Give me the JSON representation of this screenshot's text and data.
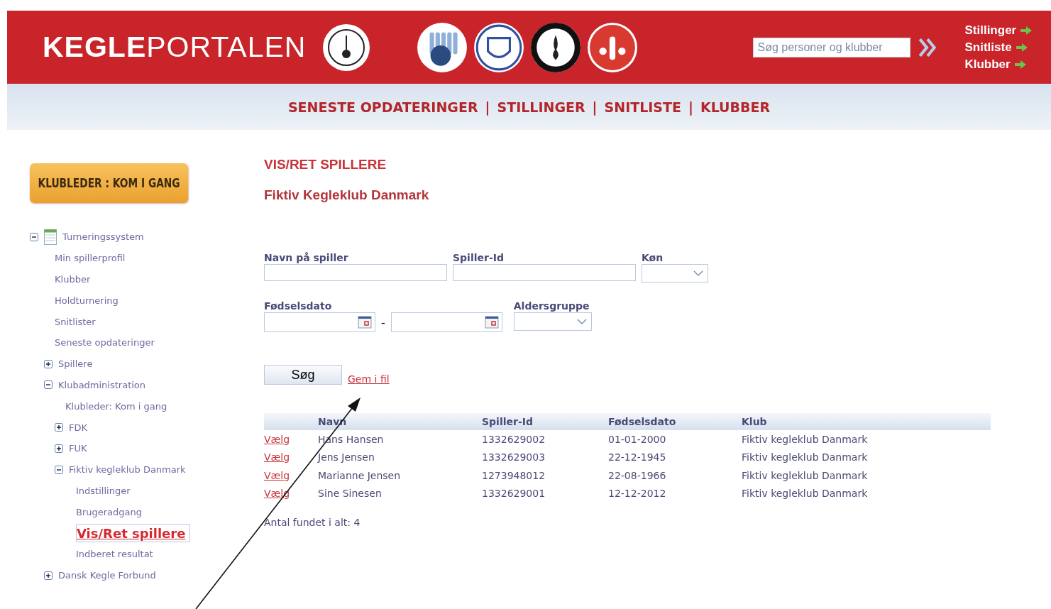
{
  "header": {
    "logo": "**KEGLE**PORTALEN",
    "search": {
      "placeholder": "Søg personer og klubber"
    },
    "quick_links": [
      "Stillinger",
      "Snitliste",
      "Klubber"
    ]
  },
  "nav": {
    "separator": "|",
    "links": [
      "SENESTE OPDATERINGER",
      "STILLINGER",
      "SNITLISTE",
      "KLUBBER"
    ]
  },
  "sidebar": {
    "button": "KLUBLEDER : KOM I GANG",
    "tree": [
      {
        "label": "Turneringssystem",
        "expanded": true,
        "selected": false,
        "children": [
          {
            "label": "Min spillerprofil",
            "selected": false
          },
          {
            "label": "Klubber",
            "selected": false
          },
          {
            "label": "Holdturnering",
            "selected": false
          },
          {
            "label": "Snitlister",
            "selected": false
          },
          {
            "label": "Seneste opdateringer",
            "selected": false
          },
          {
            "label": "Spillere",
            "expanded": false,
            "selected": false
          },
          {
            "label": "Klubadministration",
            "expanded": true,
            "selected": false,
            "children": [
              {
                "label": "Klubleder: Kom i gang",
                "selected": false
              },
              {
                "label": "FDK",
                "expanded": false,
                "selected": false
              },
              {
                "label": "FUK",
                "expanded": false,
                "selected": false
              },
              {
                "label": "Fiktiv kegleklub Danmark",
                "expanded": true,
                "selected": false,
                "children": [
                  {
                    "label": "Indstillinger",
                    "selected": false
                  },
                  {
                    "label": "Brugeradgang",
                    "selected": false
                  },
                  {
                    "label": "Vis/Ret spillere",
                    "selected": true
                  },
                  {
                    "label": "Indberet resultat",
                    "selected": false
                  }
                ]
              }
            ]
          },
          {
            "label": "Dansk Kegle Forbund",
            "expanded": false,
            "selected": false
          }
        ]
      }
    ]
  },
  "main": {
    "title": "VIS/RET SPILLERE",
    "club": "Fiktiv Kegleklub Danmark",
    "fields": {
      "name_label": "Navn på spiller",
      "id_label": "Spiller-Id",
      "gender_label": "Køn",
      "birth_label": "Fødselsdato",
      "range_separator": "-",
      "age_label": "Aldersgruppe"
    },
    "search_button": "Søg",
    "save_link": "Gem i fil",
    "table": {
      "columns": [
        "Navn",
        "Spiller-Id",
        "Fødselsdato",
        "Klub"
      ],
      "rows": [
        {
          "action": "Vælg",
          "name": "Hans Hansen",
          "id": "1332629002",
          "birth": "01-01-2000",
          "club": "Fiktiv kegleklub Danmark"
        },
        {
          "action": "Vælg",
          "name": "Jens Jensen",
          "id": "1332629003",
          "birth": "22-12-1945",
          "club": "Fiktiv kegleklub Danmark"
        },
        {
          "action": "Vælg",
          "name": "Marianne Jensen",
          "id": "1273948012",
          "birth": "22-08-1966",
          "club": "Fiktiv kegleklub Danmark"
        },
        {
          "action": "Vælg",
          "name": "Sine Sinesen",
          "id": "1332629001",
          "birth": "12-12-2012",
          "club": "Fiktiv kegleklub Danmark"
        }
      ]
    },
    "count": "Antal fundet i alt: 4"
  }
}
